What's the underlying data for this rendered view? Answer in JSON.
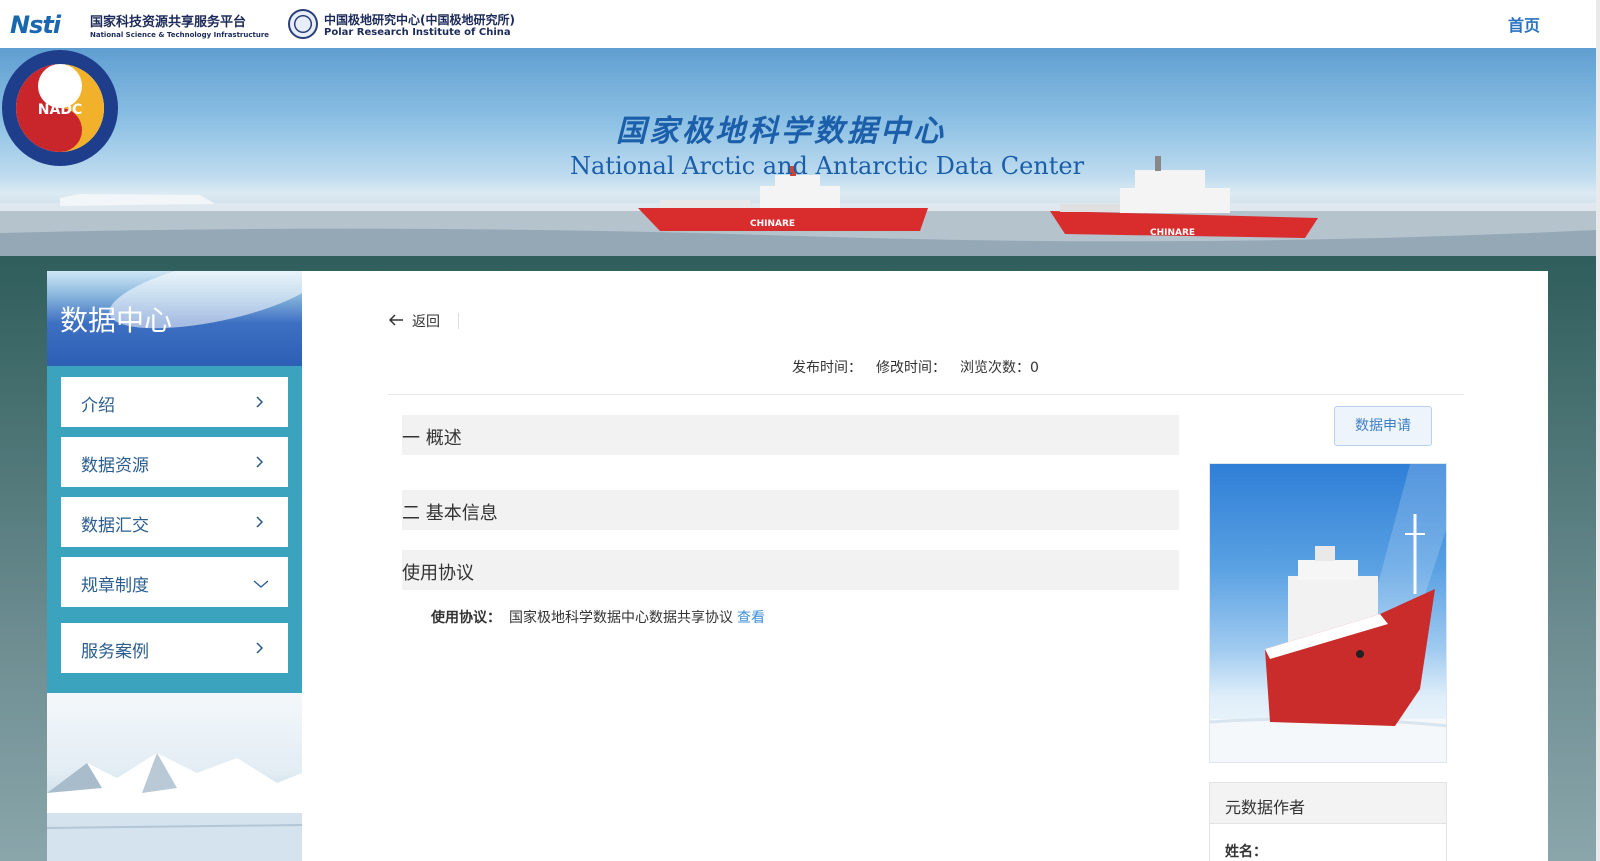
{
  "header": {
    "nsti_mark": "Nsti",
    "nsti_name_cn": "国家科技资源共享服务平台",
    "nsti_name_en": "National Science & Technology Infrastructure",
    "pri_name_cn": "中国极地研究中心(中国极地研究所)",
    "pri_name_en": "Polar Research Institute of China",
    "home_link": "首页"
  },
  "banner": {
    "seal_text": "NADC",
    "title_cn": "国家极地科学数据中心",
    "title_en": "National Arctic and Antarctic Data Center",
    "ship_name": "CHINARE"
  },
  "sidebar": {
    "title": "数据中心",
    "items": [
      {
        "label": "介绍",
        "icon": "chevron-right-icon"
      },
      {
        "label": "数据资源",
        "icon": "chevron-right-icon"
      },
      {
        "label": "数据汇交",
        "icon": "chevron-right-icon"
      },
      {
        "label": "规章制度",
        "icon": "chevron-down-icon"
      },
      {
        "label": "服务案例",
        "icon": "chevron-right-icon"
      }
    ]
  },
  "main": {
    "back_label": "返回",
    "meta": {
      "publish_label": "发布时间：",
      "modify_label": "修改时间：",
      "views_label": "浏览次数：0"
    },
    "sections": [
      {
        "title": "一 概述"
      },
      {
        "title": "二 基本信息"
      },
      {
        "title": "使用协议"
      }
    ],
    "agreement": {
      "key": "使用协议：",
      "value": "国家极地科学数据中心数据共享协议",
      "link": "查看"
    },
    "apply_button": "数据申请",
    "author": {
      "heading": "元数据作者",
      "name_label": "姓名："
    }
  },
  "colors": {
    "accent": "#2a73c0",
    "sidebar_bg": "#3ba3be",
    "link": "#3f8fd8"
  }
}
